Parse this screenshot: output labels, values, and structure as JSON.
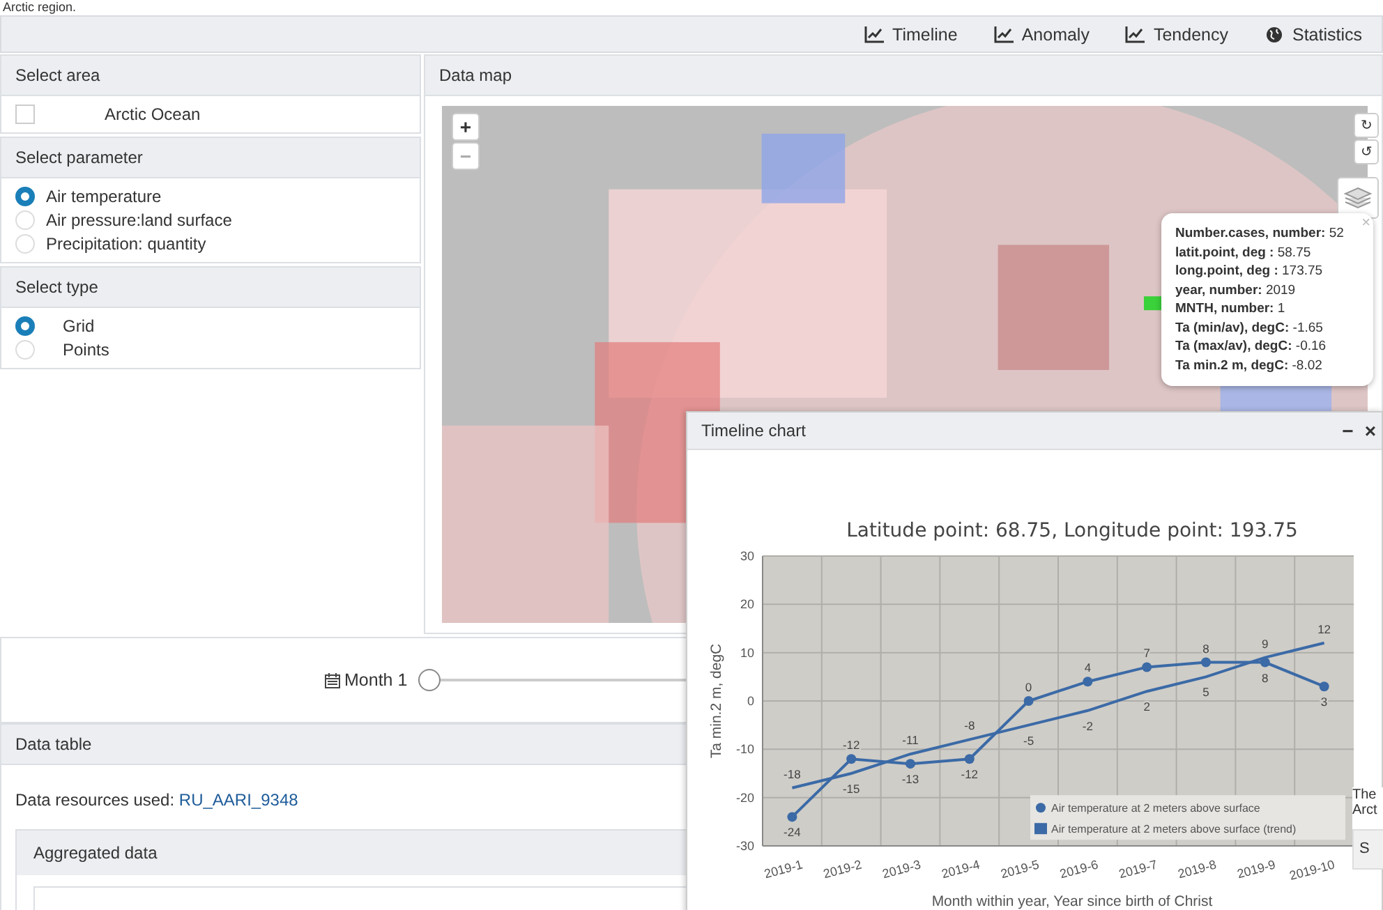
{
  "page": {
    "caption": "Arctic region."
  },
  "toolbar": [
    {
      "label": "Timeline",
      "kind": "chart"
    },
    {
      "label": "Anomaly",
      "kind": "chart"
    },
    {
      "label": "Tendency",
      "kind": "chart"
    },
    {
      "label": "Statistics",
      "kind": "globe"
    }
  ],
  "select_area": {
    "title": "Select area",
    "items": [
      {
        "label": "Arctic Ocean",
        "checked": false
      }
    ]
  },
  "select_parameter": {
    "title": "Select parameter",
    "options": [
      {
        "label": "Air temperature",
        "selected": true
      },
      {
        "label": "Air pressure:land surface",
        "selected": false
      },
      {
        "label": "Precipitation: quantity",
        "selected": false
      }
    ]
  },
  "select_type": {
    "title": "Select type",
    "options": [
      {
        "label": "Grid",
        "selected": true
      },
      {
        "label": "Points",
        "selected": false
      }
    ]
  },
  "data_map": {
    "title": "Data map",
    "zoom_in": "+",
    "zoom_out": "−",
    "rotate_cw": "↻",
    "rotate_ccw": "↺",
    "popup": {
      "close": "×",
      "lines": [
        "**Number.cases, number:** 52",
        "**latit.point, deg :** 58.75",
        "**long.point, deg :** 173.75",
        "**year, number:** 2019",
        "**MNTH, number:** 1",
        "**Ta (min/av), degC:** -1.65",
        "**Ta (max/av), degC:** -0.16",
        "**Ta min.2 m, degC:** -8.02"
      ]
    }
  },
  "month_slider": {
    "label": "Month 1",
    "level": 0
  },
  "data_table": {
    "title": "Data table",
    "resources_label": "Data resources used:",
    "resources_link": "RU_AARI_9348",
    "aggregated_title": "Aggregated data"
  },
  "side_panel": {
    "lines": [
      "The",
      "Arct"
    ],
    "row": "S"
  },
  "timeline_window": {
    "title": "Timeline chart",
    "minimize": "−",
    "close": "×",
    "chart_data": {
      "type": "line",
      "title": "Latitude point: 68.75, Longitude point: 193.75",
      "xlabel": "Month within year, Year since birth of Christ",
      "ylabel": "Ta min.2 m, degC",
      "categories": [
        "2019-1",
        "2019-2",
        "2019-3",
        "2019-4",
        "2019-5",
        "2019-6",
        "2019-7",
        "2019-8",
        "2019-9",
        "2019-10"
      ],
      "series": [
        {
          "name": "Air temperature at 2 meters above surface",
          "color": "#3b6aa6",
          "marker": "circle",
          "values": [
            -24,
            -12,
            -13,
            -12,
            0,
            4,
            7,
            8,
            8,
            3
          ]
        },
        {
          "name": "Air temperature at 2 meters above surface (trend)",
          "color": "#3b6aa6",
          "values": [
            -18,
            -15,
            -11,
            -8,
            -5,
            -2,
            2,
            5,
            9,
            12
          ]
        }
      ],
      "ylim": [
        -30,
        30
      ],
      "yticks": [
        -30,
        -20,
        -10,
        0,
        10,
        20,
        30
      ],
      "grid": true,
      "legend": true,
      "data_labels": true
    }
  }
}
